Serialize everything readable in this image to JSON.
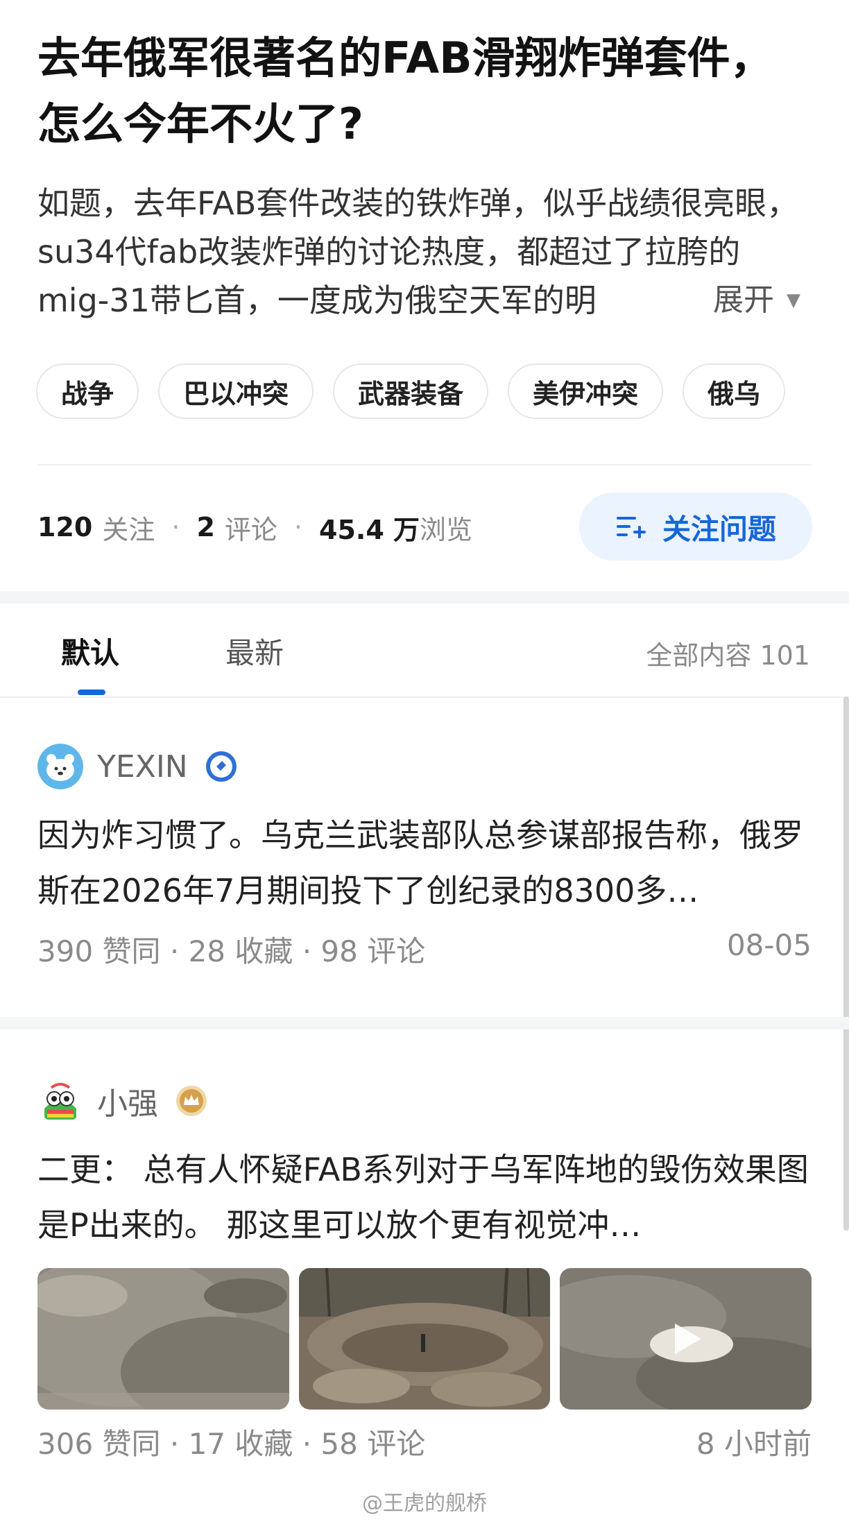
{
  "question": {
    "title": "去年俄军很著名的FAB滑翔炸弹套件，怎么今年不火了?",
    "description": "如题，去年FAB套件改装的铁炸弹，似乎战绩很亮眼，su34代fab改装炸弹的讨论热度，都超过了拉胯的mig-31带匕首，一度成为俄空天军的明",
    "expand_label": "展开",
    "tags": [
      "战争",
      "巴以冲突",
      "武器装备",
      "美伊冲突",
      "俄乌"
    ]
  },
  "stats": {
    "follow_count": "120",
    "follow_label": "关注",
    "comment_count": "2",
    "comment_label": "评论",
    "view_count": "45.4 万",
    "view_label": "浏览",
    "separator": "·"
  },
  "follow_button": {
    "label": "关注问题",
    "accent": "#1766d9",
    "bg": "#ebf3ff"
  },
  "tabs": {
    "default_label": "默认",
    "latest_label": "最新",
    "count_label": "全部内容 101"
  },
  "answers": [
    {
      "author": "YEXIN",
      "badge_icon": "verified-badge-icon",
      "excerpt": "因为炸习惯了。乌克兰武装部队总参谋部报告称，俄罗斯在2026年7月期间投下了创纪录的8300多…",
      "meta_left": "390 赞同 · 28 收藏 · 98 评论",
      "meta_right": "08-05"
    },
    {
      "author": "小强",
      "badge_icon": "crown-badge-icon",
      "excerpt": "二更： 总有人怀疑FAB系列对于乌军阵地的毁伤效果图是P出来的。 那这里可以放个更有视觉冲…",
      "meta_left": "306 赞同 · 17 收藏 · 58 评论",
      "meta_right": "8 小时前"
    }
  ],
  "watermark": "@王虎的舰桥"
}
